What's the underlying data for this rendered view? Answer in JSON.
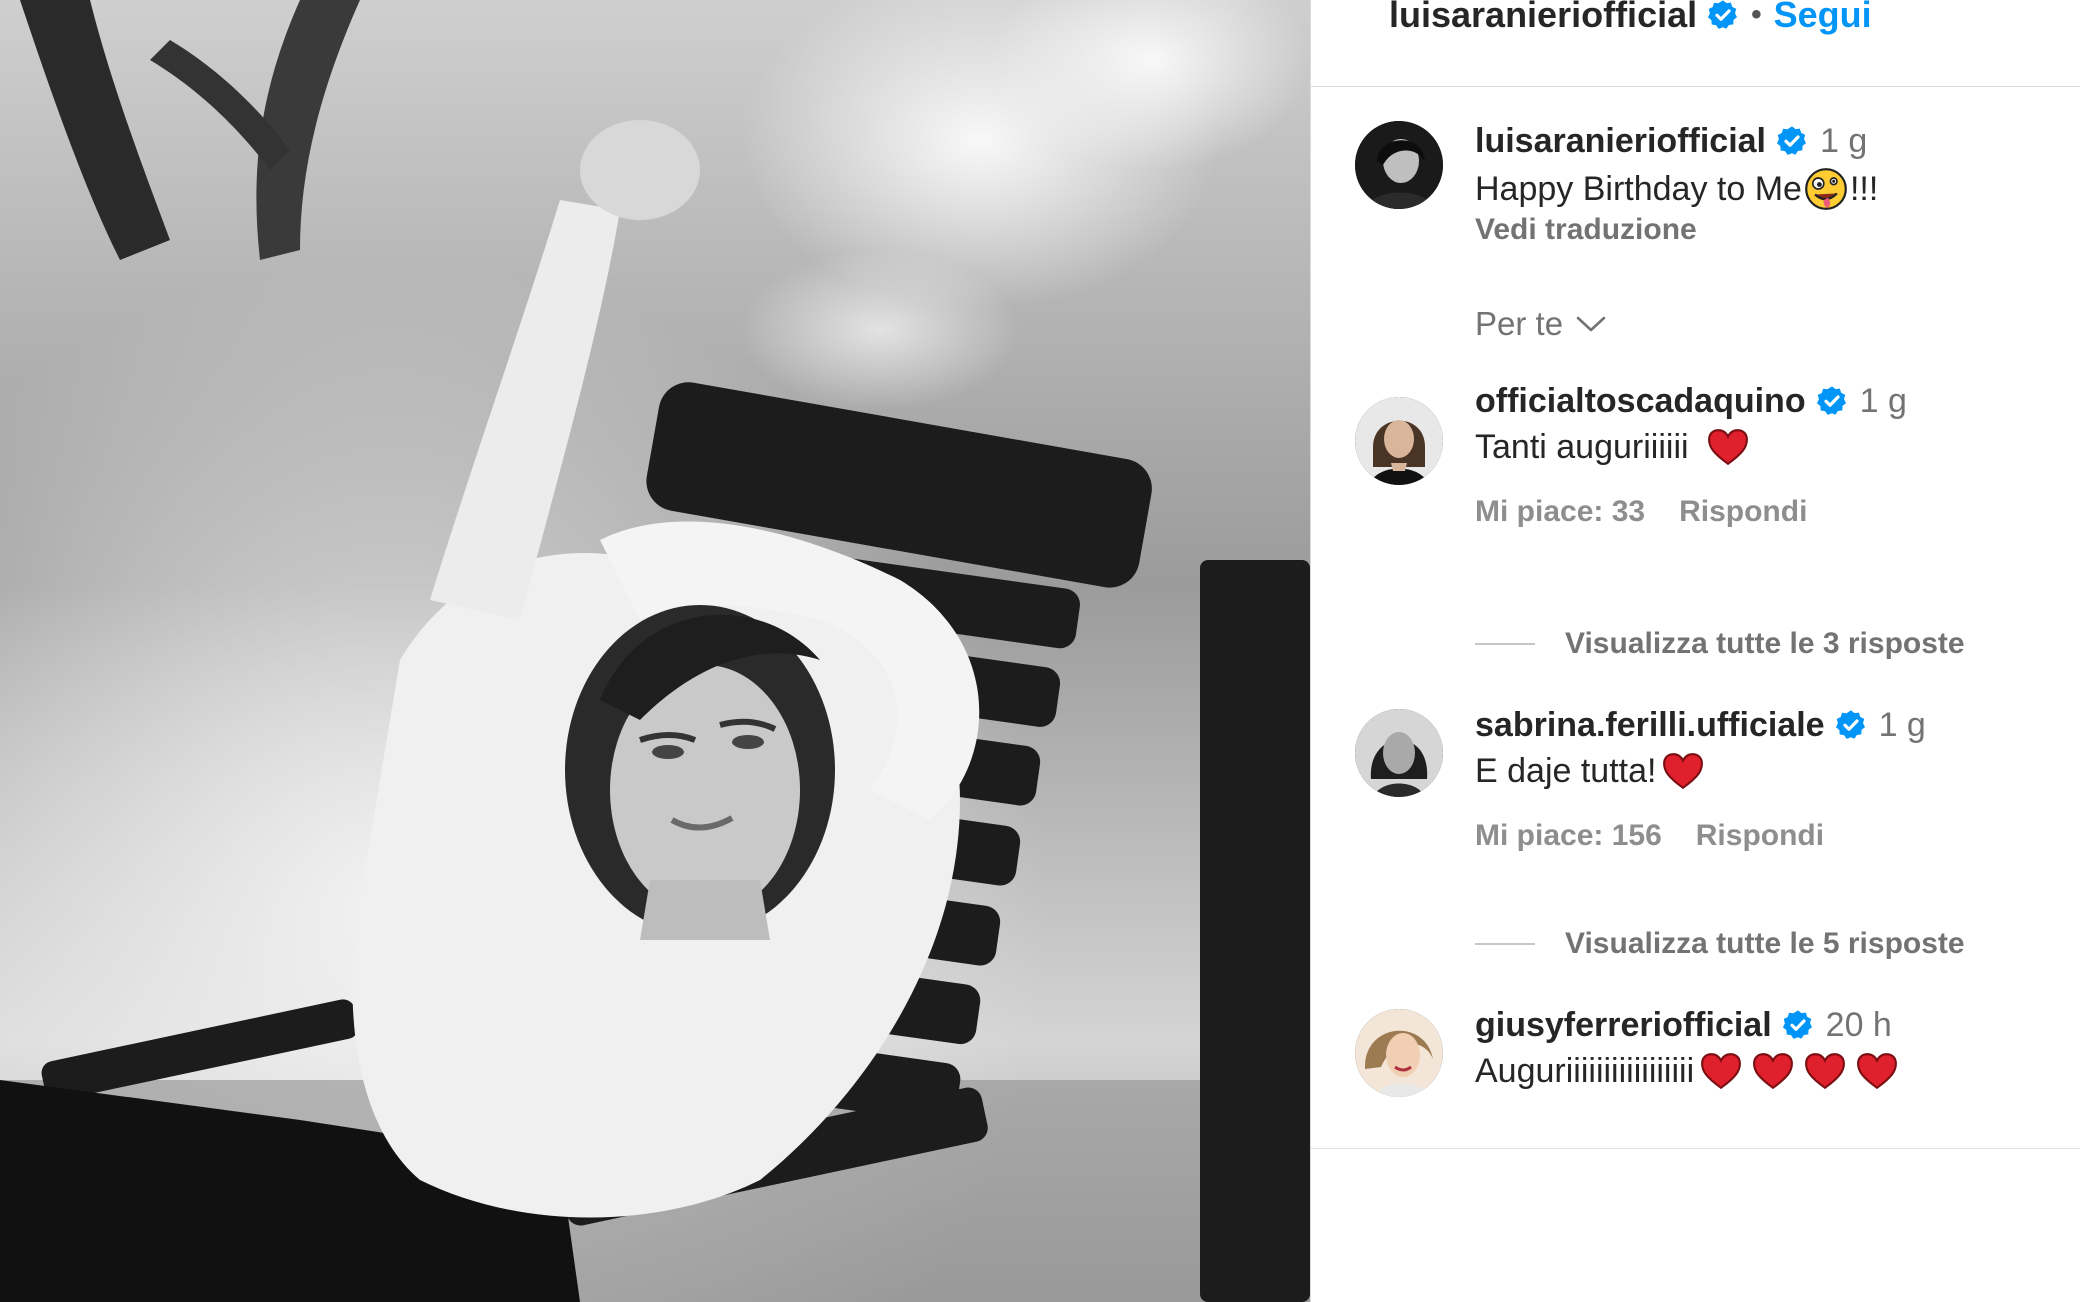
{
  "header": {
    "username": "luisaranieriofficial",
    "separator": "•",
    "follow_label": "Segui"
  },
  "caption": {
    "username": "luisaranieriofficial",
    "time": "1 g",
    "text_before": "Happy Birthday to Me",
    "text_after": "!!!",
    "translate_label": "Vedi traduzione"
  },
  "sort": {
    "label": "Per te"
  },
  "comments": [
    {
      "username": "officialtoscadaquino",
      "time": "1 g",
      "text": "Tanti auguriiiiii",
      "likes_label": "Mi piace: 33",
      "reply_label": "Rispondi",
      "view_replies": "Visualizza tutte le 3 risposte"
    },
    {
      "username": "sabrina.ferilli.ufficiale",
      "time": "1 g",
      "text": "E daje tutta!",
      "likes_label": "Mi piace: 156",
      "reply_label": "Rispondi",
      "view_replies": "Visualizza tutte le 5 risposte"
    },
    {
      "username": "giusyferreriofficial",
      "time": "20 h",
      "text": "Auguriiiiiiiiiiiiiiiii",
      "heart_count": 4
    }
  ],
  "icons": {
    "verified": "verified-badge-icon",
    "chevron": "chevron-down-icon",
    "heart": "red-heart-emoji",
    "winking_face": "zany-face-emoji"
  },
  "colors": {
    "accent": "#0095f6",
    "verified": "#0095f6",
    "heart": "#e0202c",
    "muted": "#737373"
  }
}
